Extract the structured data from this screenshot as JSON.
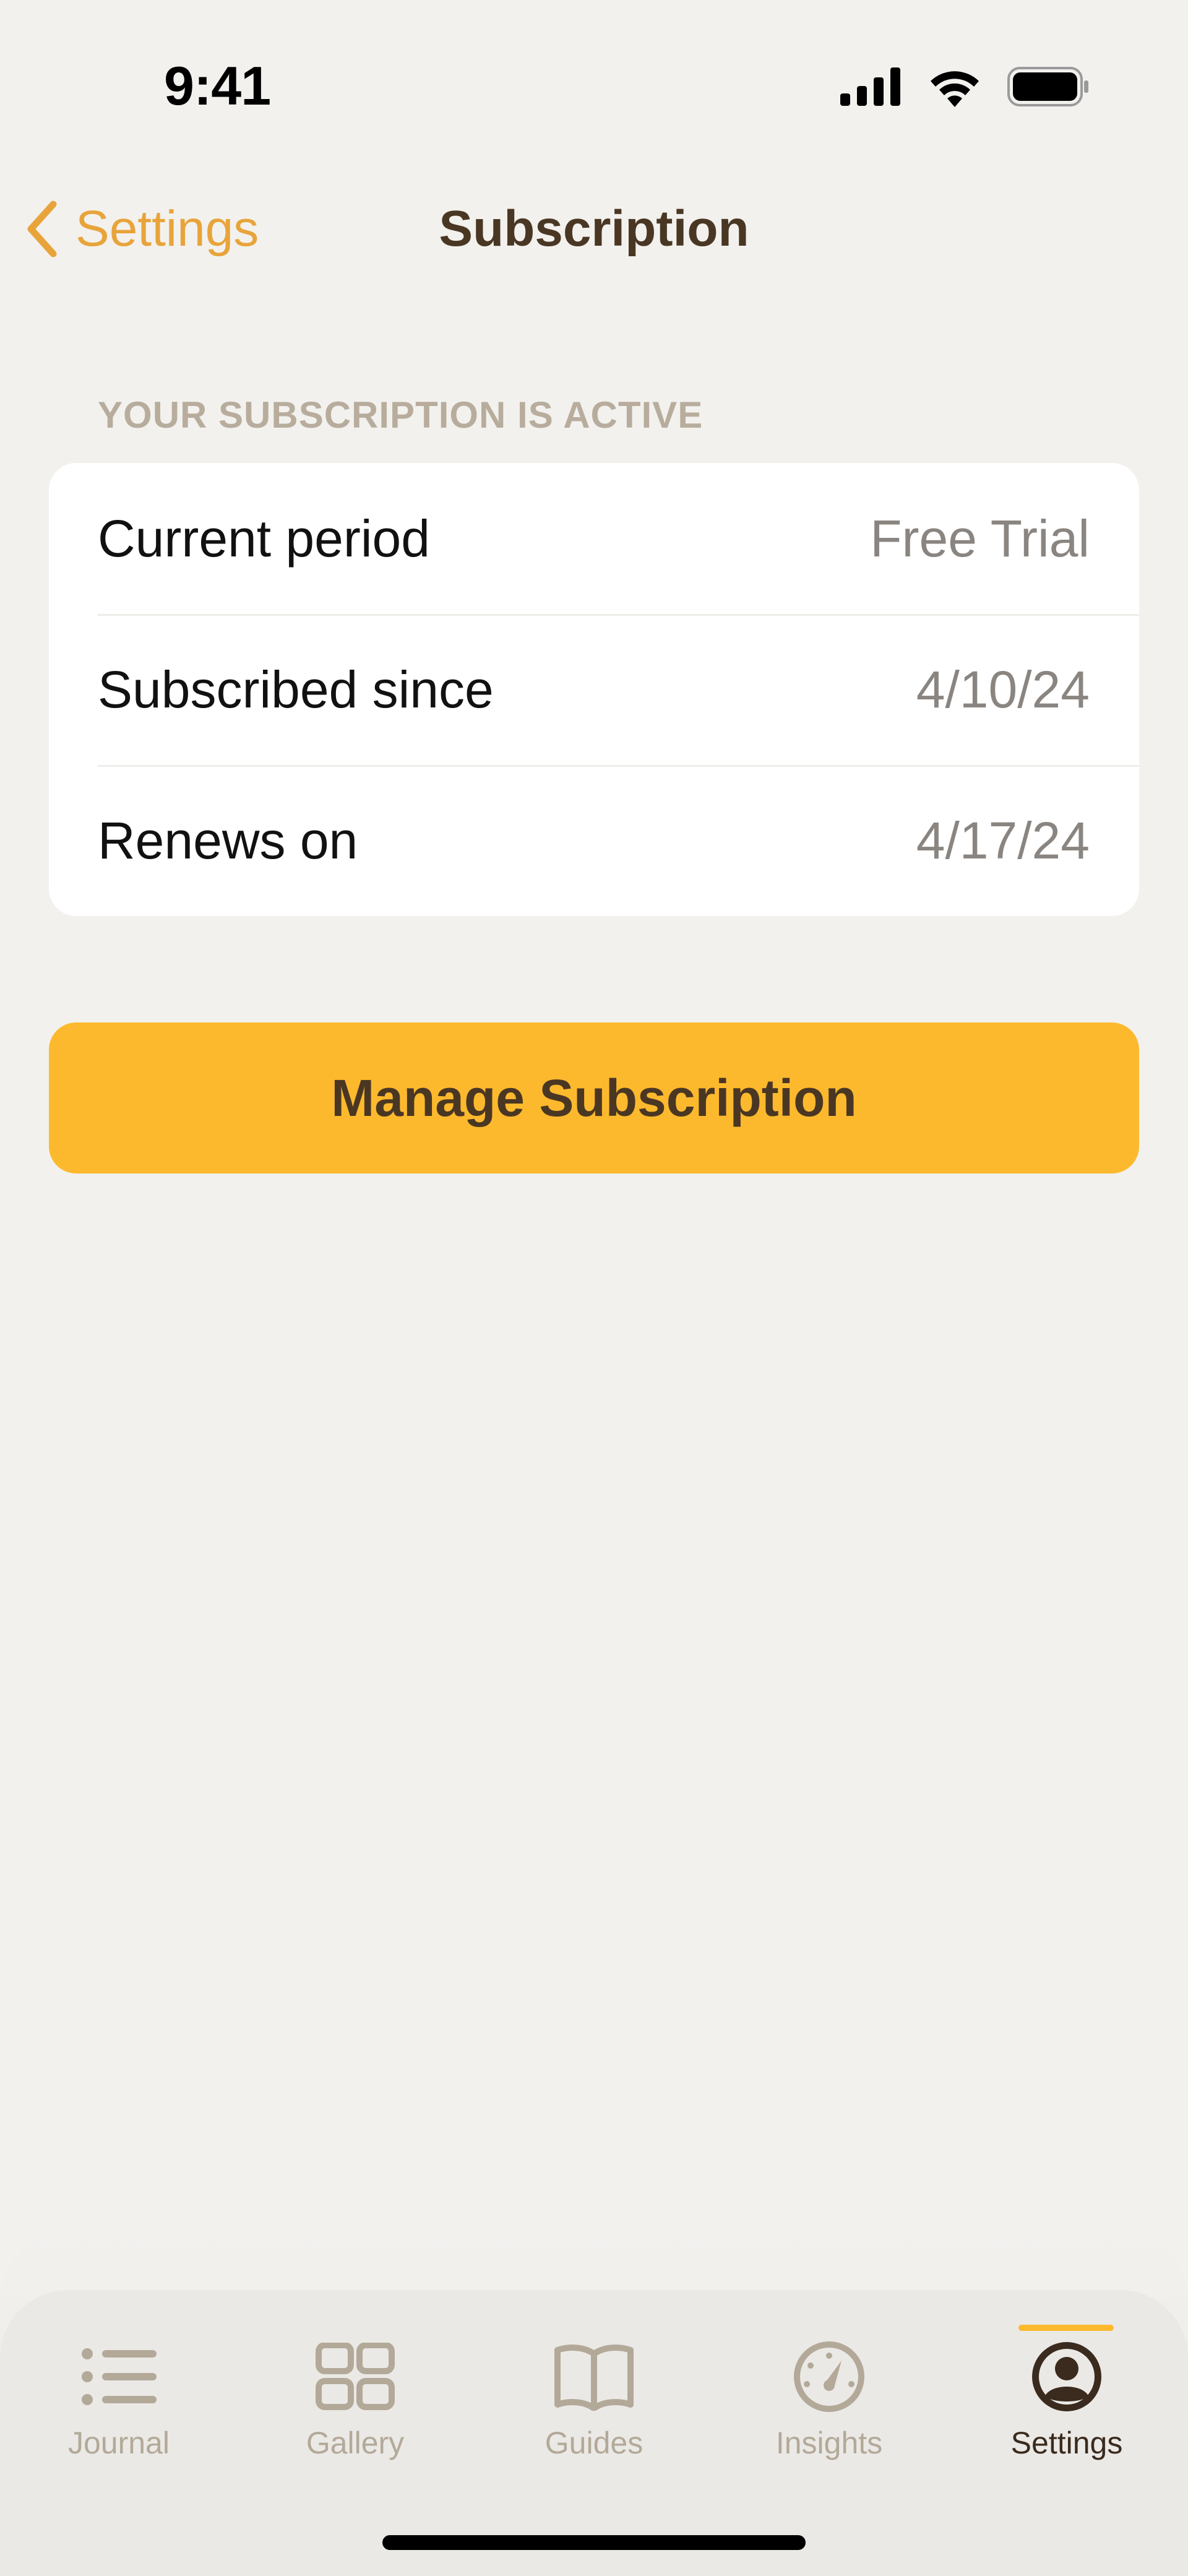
{
  "status_bar": {
    "time": "9:41"
  },
  "nav": {
    "back_label": "Settings",
    "title": "Subscription"
  },
  "section_header": "YOUR SUBSCRIPTION IS ACTIVE",
  "rows": [
    {
      "label": "Current period",
      "value": "Free Trial"
    },
    {
      "label": "Subscribed since",
      "value": "4/10/24"
    },
    {
      "label": "Renews on",
      "value": "4/17/24"
    }
  ],
  "manage_button": "Manage Subscription",
  "tabs": [
    {
      "label": "Journal",
      "icon": "list-icon"
    },
    {
      "label": "Gallery",
      "icon": "grid-icon"
    },
    {
      "label": "Guides",
      "icon": "book-icon"
    },
    {
      "label": "Insights",
      "icon": "gauge-icon"
    },
    {
      "label": "Settings",
      "icon": "person-circle-icon"
    }
  ],
  "active_tab": "Settings",
  "colors": {
    "accent": "#fdb92d",
    "accent_text": "#e8a43a",
    "title": "#4a3723",
    "background": "#f2f1ee"
  }
}
